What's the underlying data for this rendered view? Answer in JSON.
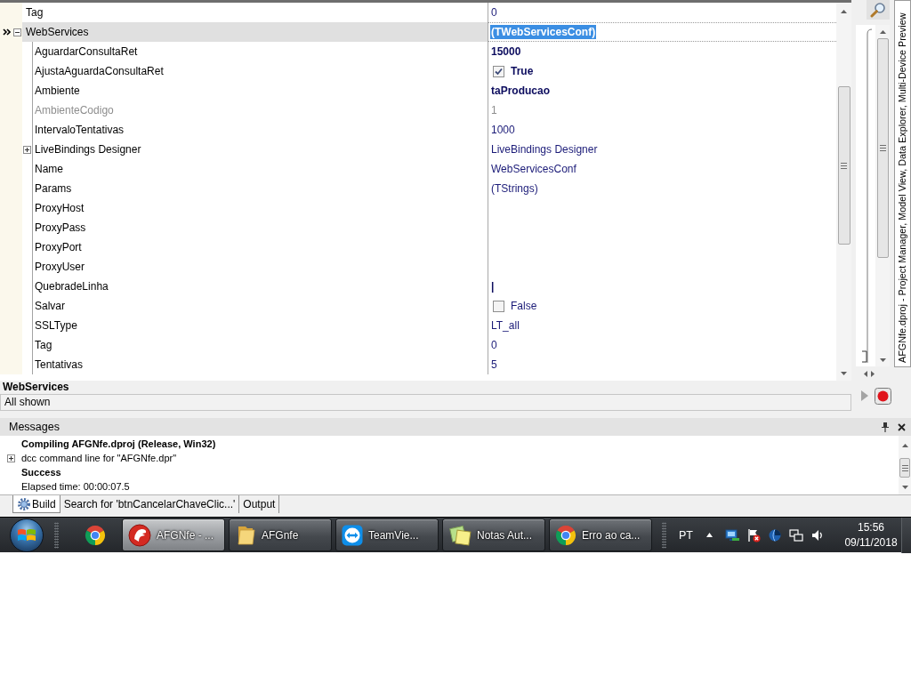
{
  "property_grid": {
    "rows": [
      {
        "name": "Tag",
        "value": "0",
        "kind": "text",
        "selected": false,
        "modified": false,
        "disabled": false
      },
      {
        "name": "WebServices",
        "value": "(TWebServicesConf)",
        "kind": "text",
        "selected": true,
        "modified": true,
        "disabled": false,
        "expanded": true,
        "children": [
          {
            "name": "AguardarConsultaRet",
            "value": "15000",
            "kind": "text",
            "selected": false,
            "modified": true,
            "disabled": false
          },
          {
            "name": "AjustaAguardaConsultaRet",
            "value": "True",
            "kind": "checkbox",
            "checked": true,
            "selected": false,
            "modified": true,
            "disabled": false
          },
          {
            "name": "Ambiente",
            "value": "taProducao",
            "kind": "text",
            "selected": false,
            "modified": true,
            "disabled": false
          },
          {
            "name": "AmbienteCodigo",
            "value": "1",
            "kind": "text",
            "selected": false,
            "modified": false,
            "disabled": true
          },
          {
            "name": "IntervaloTentativas",
            "value": "1000",
            "kind": "text",
            "selected": false,
            "modified": false,
            "disabled": false
          },
          {
            "name": "LiveBindings Designer",
            "value": "LiveBindings Designer",
            "kind": "text",
            "selected": false,
            "modified": false,
            "disabled": false,
            "expanded": false
          },
          {
            "name": "Name",
            "value": "WebServicesConf",
            "kind": "text",
            "selected": false,
            "modified": false,
            "disabled": false
          },
          {
            "name": "Params",
            "value": "(TStrings)",
            "kind": "text",
            "selected": false,
            "modified": false,
            "disabled": false
          },
          {
            "name": "ProxyHost",
            "kind": "text",
            "selected": false,
            "disabled": false
          },
          {
            "name": "ProxyPass",
            "kind": "text",
            "selected": false,
            "disabled": false
          },
          {
            "name": "ProxyPort",
            "kind": "text",
            "selected": false,
            "disabled": false
          },
          {
            "name": "ProxyUser",
            "kind": "text",
            "selected": false,
            "disabled": false
          },
          {
            "name": "QuebradeLinha",
            "value": "|",
            "kind": "text",
            "selected": false,
            "modified": true,
            "disabled": false
          },
          {
            "name": "Salvar",
            "value": "False",
            "kind": "checkbox",
            "checked": false,
            "selected": false,
            "modified": false,
            "disabled": false
          },
          {
            "name": "SSLType",
            "value": "LT_all",
            "kind": "text",
            "selected": false,
            "modified": false,
            "disabled": false
          },
          {
            "name": "Tag",
            "value": "0",
            "kind": "text",
            "selected": false,
            "modified": false,
            "disabled": false
          },
          {
            "name": "Tentativas",
            "value": "5",
            "kind": "text",
            "selected": false,
            "modified": false,
            "disabled": false
          }
        ]
      }
    ],
    "description_title": "WebServices",
    "status": "All shown"
  },
  "side_tab": {
    "label": "AFGNfe.dproj - Project Manager, Model View, Data Explorer, Multi-Device Preview"
  },
  "messages": {
    "title": "Messages",
    "items": [
      {
        "kind": "heading",
        "text": "Compiling AFGNfe.dproj (Release, Win32)"
      },
      {
        "kind": "group",
        "text": "dcc command line for \"AFGNfe.dpr\"",
        "expanded": false
      },
      {
        "kind": "heading",
        "text": "Success"
      },
      {
        "kind": "text",
        "text": "Elapsed time: 00:00:07.5"
      }
    ],
    "tabs": [
      {
        "label": "Build",
        "kind": "icon",
        "selected": true
      },
      {
        "label": "Search for 'btnCancelarChaveClic...'",
        "kind": "plain",
        "selected": false
      },
      {
        "label": "Output",
        "kind": "plain",
        "selected": false
      }
    ]
  },
  "taskbar": {
    "tasks": [
      {
        "label": "AFGNfe - ...",
        "kind": "helmet",
        "selected": true
      },
      {
        "label": "AFGnfe",
        "kind": "folder",
        "selected": false
      },
      {
        "label": "TeamVie...",
        "kind": "arrows",
        "selected": false
      },
      {
        "label": "Notas Aut...",
        "kind": "notes",
        "selected": false
      },
      {
        "label": "Erro ao ca...",
        "kind": "browser",
        "selected": false
      }
    ],
    "tray": {
      "language": "PT",
      "time": "15:56",
      "date": "09/11/2018"
    }
  }
}
